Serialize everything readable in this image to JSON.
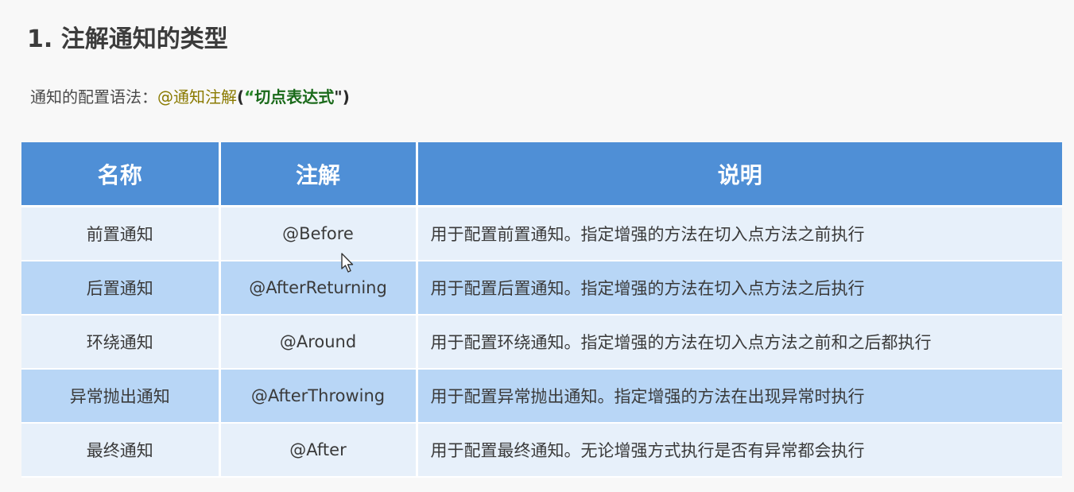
{
  "title": "1. 注解通知的类型",
  "syntax": {
    "prefix": "通知的配置语法：",
    "annotation": "@通知注解",
    "open": "(",
    "quote_open": "“",
    "pointcut": "切点表达式",
    "quote_close": "\"",
    "close": ")"
  },
  "table": {
    "headers": [
      "名称",
      "注解",
      "说明"
    ],
    "rows": [
      {
        "name": "前置通知",
        "annotation": "@Before",
        "description": "用于配置前置通知。指定增强的方法在切入点方法之前执行"
      },
      {
        "name": "后置通知",
        "annotation": "@AfterReturning",
        "description": "用于配置后置通知。指定增强的方法在切入点方法之后执行"
      },
      {
        "name": "环绕通知",
        "annotation": "@Around",
        "description": "用于配置环绕通知。指定增强的方法在切入点方法之前和之后都执行"
      },
      {
        "name": "异常抛出通知",
        "annotation": "@AfterThrowing",
        "description": "用于配置异常抛出通知。指定增强的方法在出现异常时执行"
      },
      {
        "name": "最终通知",
        "annotation": "@After",
        "description": "用于配置最终通知。无论增强方式执行是否有异常都会执行"
      }
    ]
  },
  "colors": {
    "header": "#4f8fd6",
    "row_light": "#e7f0fa",
    "row_dark": "#b8d6f6",
    "annotation_text": "#8a7a00",
    "pointcut_text": "#1a6a1a"
  },
  "icons": {
    "cursor": "mouse-pointer-icon"
  }
}
